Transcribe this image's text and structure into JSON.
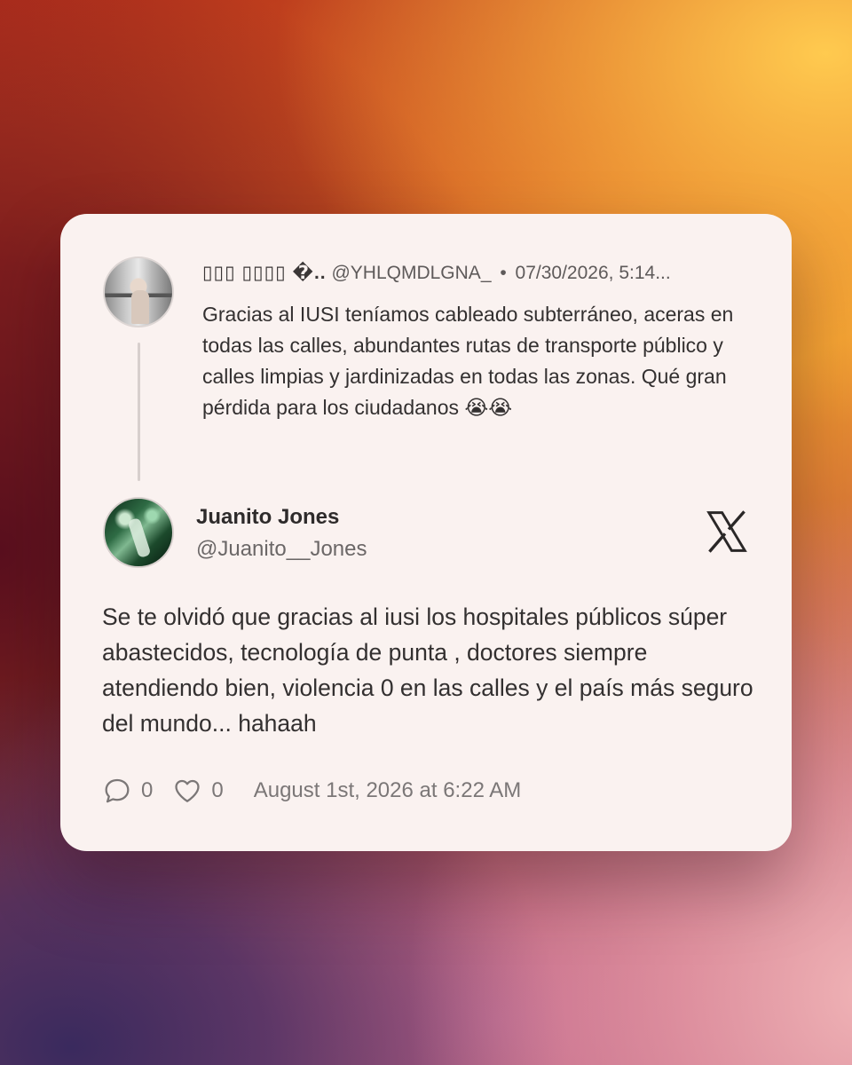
{
  "quoted_tweet": {
    "display_name": "▯▯▯ ▯▯▯▯ �..",
    "handle": "@YHLQMDLGNA_",
    "separator": "•",
    "timestamp": "07/30/2026, 5:14...",
    "text": "Gracias al IUSI teníamos cableado subterráneo, aceras en todas las calles, abundantes rutas de transporte público y calles limpias y jardinizadas en todas las zonas. Qué gran pérdida para los ciudadanos 😭😭"
  },
  "tweet": {
    "author_name": "Juanito Jones",
    "author_handle": "@Juanito__Jones",
    "text": "Se te olvidó que gracias al iusi los hospitales públicos súper abastecidos, tecnología de punta , doctores siempre atendiendo bien, violencia 0 en las calles y el país más seguro del mundo... hahaah",
    "reply_count": "0",
    "like_count": "0",
    "date": "August 1st, 2026 at 6:22 AM"
  },
  "icons": {
    "reply": "comment-bubble-icon",
    "like": "heart-icon",
    "brand": "x-logo-icon"
  },
  "colors": {
    "card_background": "#faf2f0",
    "text_primary": "#333030",
    "text_secondary": "#6b6767"
  }
}
